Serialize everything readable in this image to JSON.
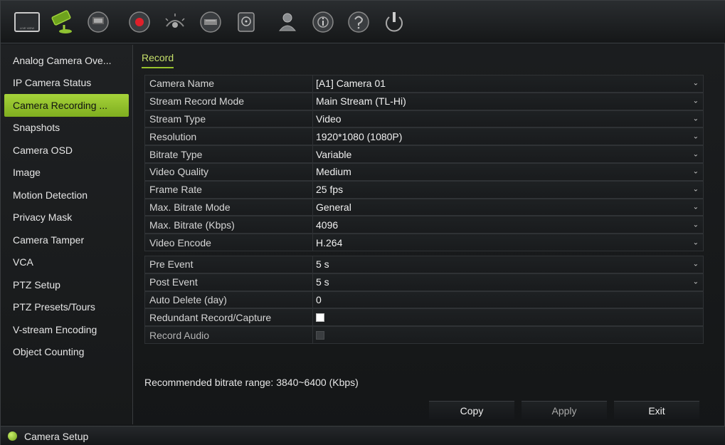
{
  "toolbar": {
    "icons": [
      "live-view-icon",
      "camera-setup-icon",
      "network-icon",
      "record-icon",
      "alarm-icon",
      "device-icon",
      "storage-icon",
      "user-icon",
      "system-info-icon",
      "help-icon",
      "shutdown-icon"
    ],
    "live_view_caption": "LIVE VIEW",
    "record_color": "#e0202a",
    "accent": "#98c22c"
  },
  "sidebar": {
    "items": [
      {
        "label": "Analog Camera Ove..."
      },
      {
        "label": "IP Camera Status"
      },
      {
        "label": "Camera Recording ..."
      },
      {
        "label": "Snapshots"
      },
      {
        "label": "Camera OSD"
      },
      {
        "label": "Image"
      },
      {
        "label": "Motion Detection"
      },
      {
        "label": "Privacy Mask"
      },
      {
        "label": "Camera Tamper"
      },
      {
        "label": "VCA"
      },
      {
        "label": "PTZ Setup"
      },
      {
        "label": "PTZ Presets/Tours"
      },
      {
        "label": "V-stream Encoding"
      },
      {
        "label": "Object Counting"
      }
    ],
    "active_index": 2
  },
  "main": {
    "tab": "Record",
    "fields": [
      {
        "label": "Camera Name",
        "value": "[A1] Camera 01",
        "dropdown": true
      },
      {
        "label": "Stream Record Mode",
        "value": "Main Stream (TL-Hi)",
        "dropdown": true
      },
      {
        "label": "Stream Type",
        "value": "Video",
        "dropdown": true
      },
      {
        "label": "Resolution",
        "value": "1920*1080 (1080P)",
        "dropdown": true
      },
      {
        "label": "Bitrate Type",
        "value": "Variable",
        "dropdown": true
      },
      {
        "label": "Video Quality",
        "value": "Medium",
        "dropdown": true
      },
      {
        "label": "Frame Rate",
        "value": "25 fps",
        "dropdown": true
      },
      {
        "label": "Max. Bitrate Mode",
        "value": "General",
        "dropdown": true
      },
      {
        "label": "Max. Bitrate (Kbps)",
        "value": "4096",
        "dropdown": true
      },
      {
        "label": "Video Encode",
        "value": "H.264",
        "dropdown": true
      }
    ],
    "fields2": [
      {
        "label": "Pre Event",
        "value": "5 s",
        "dropdown": true
      },
      {
        "label": "Post Event",
        "value": "5 s",
        "dropdown": true
      },
      {
        "label": "Auto Delete (day)",
        "value": "0",
        "dropdown": false
      },
      {
        "label": "Redundant Record/Capture",
        "checkbox": true,
        "checked": false,
        "disabled": false
      },
      {
        "label": "Record Audio",
        "checkbox": true,
        "checked": false,
        "disabled": true
      }
    ],
    "recommend_text": "Recommended bitrate range: 3840~6400 (Kbps)",
    "buttons": {
      "copy": "Copy",
      "apply": "Apply",
      "exit": "Exit"
    }
  },
  "statusbar": {
    "label": "Camera Setup"
  }
}
